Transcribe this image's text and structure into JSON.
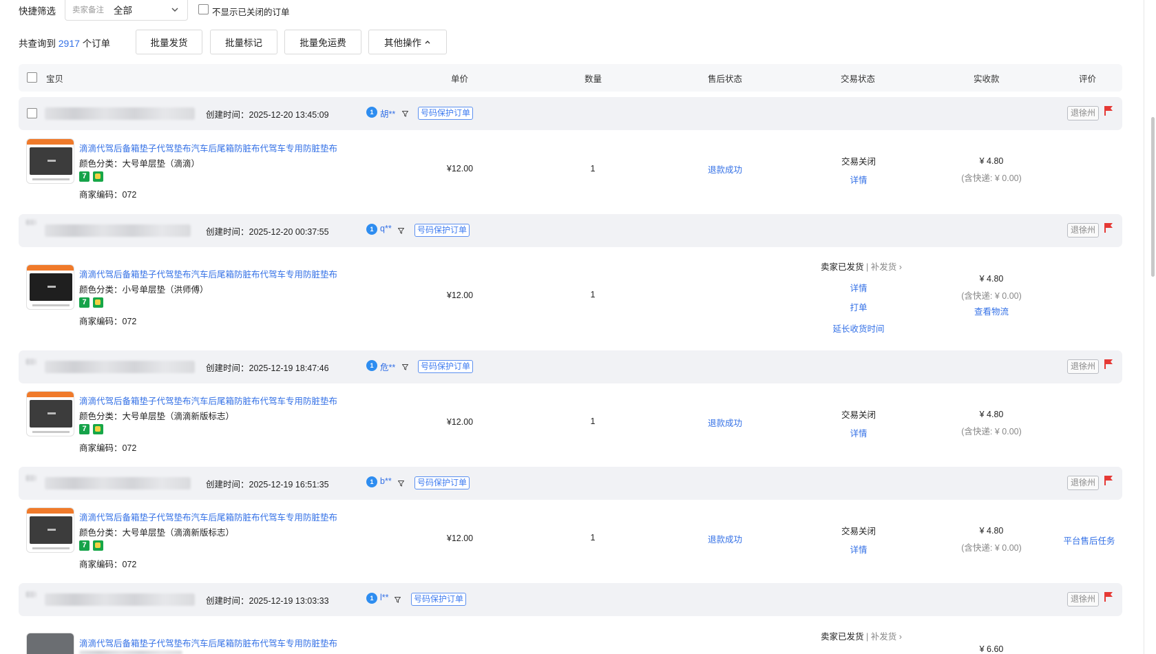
{
  "filter": {
    "label": "快捷筛选",
    "seller_note_label": "卖家备注",
    "seller_note_value": "全部",
    "hide_closed_label": "不显示已关闭的订单"
  },
  "actions": {
    "total_prefix": "共查询到",
    "total_count": "2917",
    "total_suffix": "个订单",
    "batch_ship": "批量发货",
    "batch_mark": "批量标记",
    "batch_free_shipping": "批量免运费",
    "other_ops": "其他操作"
  },
  "table_header": {
    "item": "宝贝",
    "unit_price": "单价",
    "quantity": "数量",
    "after_sale": "售后状态",
    "trade_status": "交易状态",
    "received": "实收款",
    "review": "评价"
  },
  "labels": {
    "created_prefix": "创建时间：",
    "protect_tag": "号码保护订单",
    "city": "退徐州",
    "variant_prefix": "颜色分类：",
    "code_prefix": "商家编码：",
    "detail": "详情"
  },
  "colors": {
    "accent": "#3370e6",
    "flag": "#e53935",
    "header_bg": "#f1f2f5"
  },
  "orders": [
    {
      "created": "2025-12-20 13:45:09",
      "buyer": "胡**",
      "title": "滴滴代驾后备箱垫子代驾垫布汽车后尾箱防脏布代驾车专用防脏垫布",
      "variant": "大号单层垫（滴滴）",
      "code": "072",
      "price": "¥12.00",
      "qty": "1",
      "after_sale": "退款成功",
      "status": "交易关闭",
      "detail": "详情",
      "received": "¥ 4.80",
      "shipping": "(含快递: ¥ 0.00)"
    },
    {
      "created": "2025-12-20 00:37:55",
      "buyer": "q**",
      "title": "滴滴代驾后备箱垫子代驾垫布汽车后尾箱防脏布代驾车专用防脏垫布",
      "variant": "小号单层垫（洪师傅）",
      "code": "072",
      "price": "¥12.00",
      "qty": "1",
      "status": "卖家已发货",
      "reship": "补发货",
      "detail": "详情",
      "print": "打单",
      "extend": "延长收货时间",
      "received": "¥ 4.80",
      "shipping": "(含快递: ¥ 0.00)",
      "logistics": "查看物流"
    },
    {
      "created": "2025-12-19 18:47:46",
      "buyer": "危**",
      "title": "滴滴代驾后备箱垫子代驾垫布汽车后尾箱防脏布代驾车专用防脏垫布",
      "variant": "大号单层垫（滴滴新版标志）",
      "code": "072",
      "price": "¥12.00",
      "qty": "1",
      "after_sale": "退款成功",
      "status": "交易关闭",
      "detail": "详情",
      "received": "¥ 4.80",
      "shipping": "(含快递: ¥ 0.00)"
    },
    {
      "created": "2025-12-19 16:51:35",
      "buyer": "b**",
      "title": "滴滴代驾后备箱垫子代驾垫布汽车后尾箱防脏布代驾车专用防脏垫布",
      "variant": "大号单层垫（滴滴新版标志）",
      "code": "072",
      "price": "¥12.00",
      "qty": "1",
      "after_sale": "退款成功",
      "status": "交易关闭",
      "detail": "详情",
      "received": "¥ 4.80",
      "shipping": "(含快递: ¥ 0.00)",
      "review_action": "平台售后任务"
    },
    {
      "created": "2025-12-19 13:03:33",
      "buyer": "l**",
      "title": "滴滴代驾后备箱垫子代驾垫布汽车后尾箱防脏布代驾车专用防脏垫布",
      "status": "卖家已发货",
      "reship": "补发货",
      "received": "¥ 6.60"
    }
  ]
}
